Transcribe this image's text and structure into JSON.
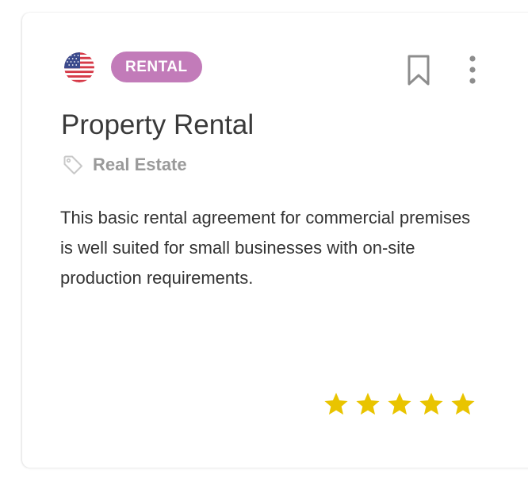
{
  "card": {
    "country_flag": "us-flag-icon",
    "badge": "RENTAL",
    "title": "Property Rental",
    "category_icon": "tag-icon",
    "category": "Real Estate",
    "description": "This basic rental agreement for commercial premises is well suited for small businesses with on-site production requirements.",
    "rating": 5,
    "rating_max": 5,
    "actions": [
      "bookmark-icon",
      "more-options-icon"
    ]
  },
  "colors": {
    "badge_bg": "#c27bb9",
    "star": "#e9c400",
    "title": "#3a3a3a",
    "muted": "#9a9a9a"
  }
}
